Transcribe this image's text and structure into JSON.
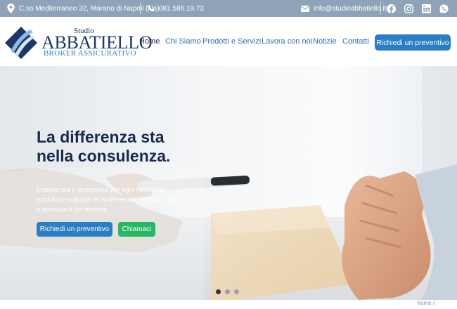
{
  "topbar": {
    "address": "C.so Mediterraneo 32, Marano di Napoli (Na)",
    "phone": "081.586.19.73",
    "email": "info@studioabbatiello.it",
    "social": [
      "facebook-icon",
      "instagram-icon",
      "linkedin-icon",
      "whatsapp-icon"
    ]
  },
  "logo": {
    "studio": "Studio",
    "name": "ABBATIELLO",
    "subtitle": "BROKER ASSICURATIVO"
  },
  "nav": {
    "items": [
      "Home",
      "Chi Siamo",
      "Prodotti e Servizi",
      "Lavora con noi",
      "Notizie",
      "Contatti"
    ],
    "active": "Home",
    "cta": "Richiedi un preventivo"
  },
  "hero": {
    "title": "La differenza sta nella consulenza.",
    "text": "Esperienza e attenzione per ogni cliente: la nostra consulenza fa la differenza. Affidati a noi e assicura il tuo domani.",
    "primary_button": "Richiedi un preventivo",
    "secondary_button": "Chiamaci",
    "slides_total": 3,
    "slide_active": 1
  },
  "breadcrumb": "home /",
  "colors": {
    "topbar": "#8ea3b8",
    "navy": "#1d3768",
    "accent_blue": "#2a7fc4",
    "green": "#27b765"
  }
}
